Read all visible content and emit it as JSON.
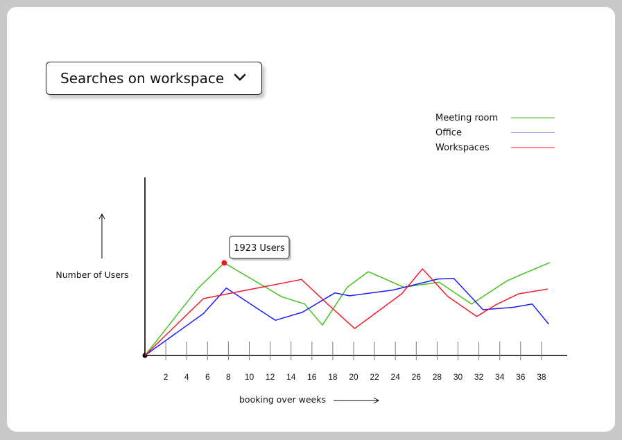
{
  "dropdown": {
    "label": "Searches on workspace",
    "icon": "chevron-down-icon"
  },
  "chart_data": {
    "type": "line",
    "x": [
      0,
      2,
      4,
      6,
      8,
      10,
      12,
      14,
      16,
      18,
      20,
      22,
      24,
      26,
      28,
      30,
      32,
      34,
      36,
      38
    ],
    "xticks": [
      "2",
      "4",
      "6",
      "8",
      "10",
      "12",
      "14",
      "16",
      "18",
      "20",
      "22",
      "24",
      "26",
      "28",
      "30",
      "32",
      "34",
      "36",
      "38"
    ],
    "xlabel": "booking over weeks",
    "ylabel": "Number of Users",
    "grid": false,
    "legend_position": "top-right",
    "series": [
      {
        "name": "Meeting room",
        "color": "#44c21c",
        "points": [
          [
            0,
            0
          ],
          [
            5.1,
            1400
          ],
          [
            7.6,
            1923
          ],
          [
            13.1,
            1220
          ],
          [
            15.3,
            1070
          ],
          [
            17.0,
            630
          ],
          [
            19.4,
            1420
          ],
          [
            21.4,
            1740
          ],
          [
            24.8,
            1420
          ],
          [
            28.2,
            1520
          ],
          [
            31.3,
            1070
          ],
          [
            34.7,
            1550
          ],
          [
            36.6,
            1730
          ],
          [
            38.8,
            1930
          ]
        ]
      },
      {
        "name": "Office",
        "color": "#1a1aff",
        "points": [
          [
            0,
            0
          ],
          [
            5.6,
            870
          ],
          [
            7.8,
            1400
          ],
          [
            12.5,
            730
          ],
          [
            15.1,
            900
          ],
          [
            18.2,
            1300
          ],
          [
            19.6,
            1240
          ],
          [
            23.8,
            1360
          ],
          [
            28.1,
            1590
          ],
          [
            29.6,
            1600
          ],
          [
            32.4,
            950
          ],
          [
            35.3,
            1000
          ],
          [
            37.1,
            1070
          ],
          [
            38.7,
            650
          ]
        ]
      },
      {
        "name": "Workspaces",
        "color": "#ee1c2c",
        "points": [
          [
            0,
            0
          ],
          [
            5.6,
            1180
          ],
          [
            7.9,
            1280
          ],
          [
            15.0,
            1580
          ],
          [
            17.6,
            1050
          ],
          [
            20.1,
            560
          ],
          [
            24.6,
            1280
          ],
          [
            26.6,
            1800
          ],
          [
            29.0,
            1230
          ],
          [
            31.8,
            810
          ],
          [
            33.6,
            1050
          ],
          [
            35.8,
            1280
          ],
          [
            38.6,
            1380
          ]
        ]
      }
    ],
    "highlight": {
      "series": "Meeting room",
      "x": 7.6,
      "y": 1923,
      "label": "1923 Users",
      "color": "#ee1c1c"
    },
    "xlim": [
      0,
      40
    ],
    "ylim": [
      0,
      3700
    ]
  }
}
